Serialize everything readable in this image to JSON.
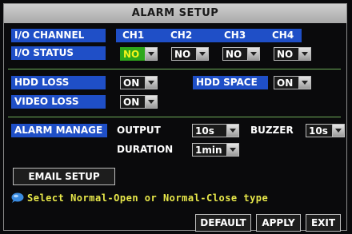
{
  "title": "ALARM SETUP",
  "io": {
    "channel_label": "I/O CHANNEL",
    "status_label": "I/O STATUS",
    "channels": [
      "CH1",
      "CH2",
      "CH3",
      "CH4"
    ],
    "statuses": [
      "NO",
      "NO",
      "NO",
      "NO"
    ]
  },
  "hdd": {
    "loss_label": "HDD LOSS",
    "loss_value": "ON",
    "space_label": "HDD SPACE",
    "space_value": "ON",
    "video_loss_label": "VIDEO LOSS",
    "video_loss_value": "ON"
  },
  "alarm_manage": {
    "label": "ALARM MANAGE",
    "output_label": "OUTPUT",
    "output_value": "10s",
    "buzzer_label": "BUZZER",
    "buzzer_value": "10s",
    "duration_label": "DURATION",
    "duration_value": "1min"
  },
  "email_button": "EMAIL SETUP",
  "tip": "Select Normal-Open or Normal-Close type",
  "buttons": {
    "default": "DEFAULT",
    "apply": "APPLY",
    "exit": "EXIT"
  },
  "colors": {
    "label_bg": "#1f4fc7",
    "active_bg": "#2ea81b",
    "tip_text": "#e8e84a"
  }
}
